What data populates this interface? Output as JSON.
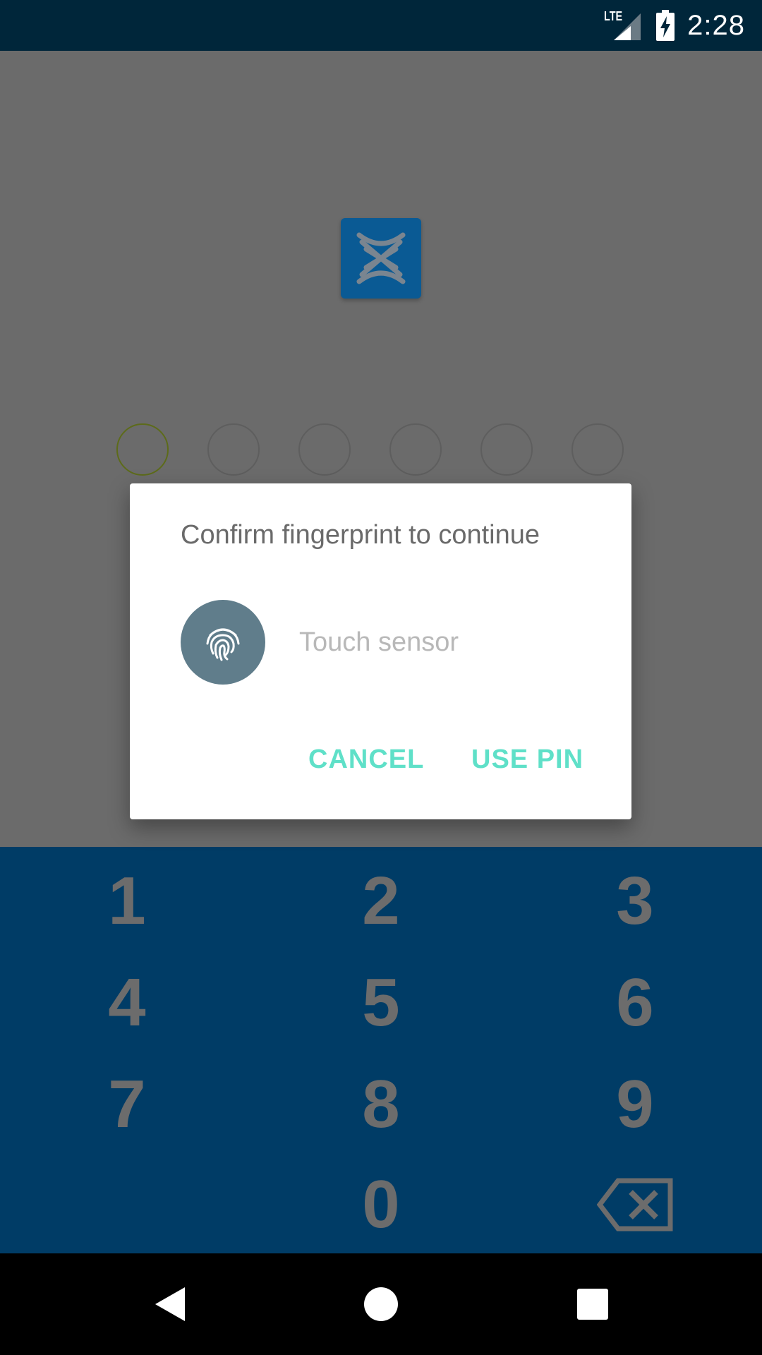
{
  "status_bar": {
    "network": "LTE",
    "time": "2:28"
  },
  "pin": {
    "length": 6,
    "active_index": 0
  },
  "keypad": {
    "keys": [
      "1",
      "2",
      "3",
      "4",
      "5",
      "6",
      "7",
      "8",
      "9",
      "0"
    ],
    "backspace_icon": "backspace-icon"
  },
  "dialog": {
    "title": "Confirm fingerprint to continue",
    "fingerprint_icon": "fingerprint-icon",
    "status": "Touch sensor",
    "cancel_label": "CANCEL",
    "use_pin_label": "USE PIN",
    "accent_color": "#5fe0c8"
  },
  "colors": {
    "status_bar": "#00263a",
    "keypad": "#003c66",
    "logo": "#0a5a94",
    "fingerprint_bg": "#607d8b"
  },
  "nav": {
    "back_icon": "back-icon",
    "home_icon": "home-icon",
    "recents_icon": "recents-icon"
  }
}
